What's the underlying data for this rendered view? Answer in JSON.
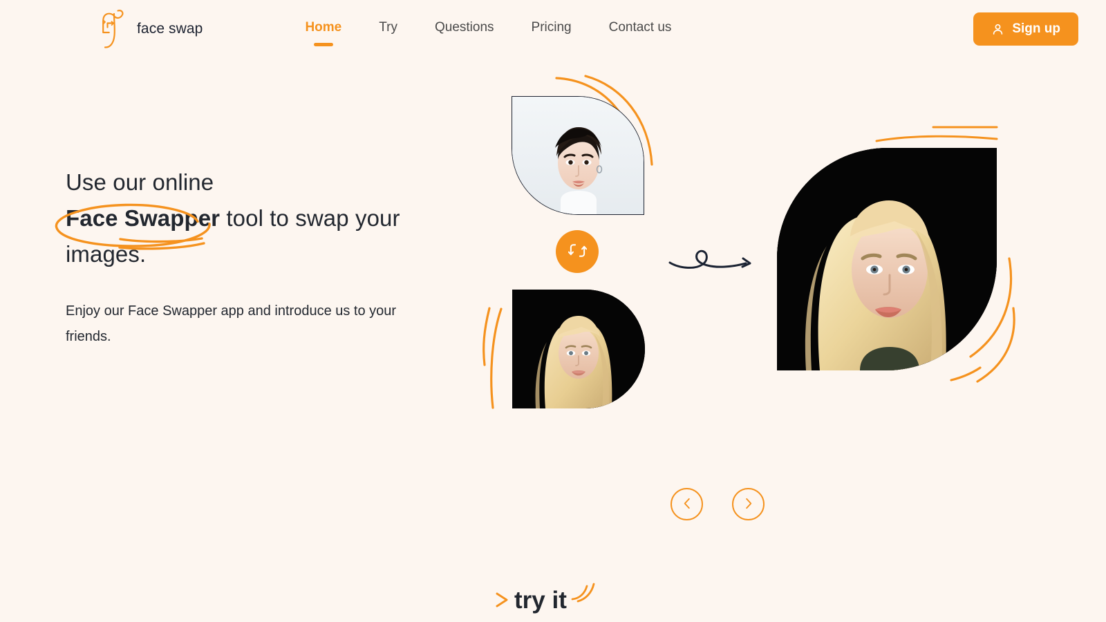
{
  "theme": {
    "background": "#FDF6F0",
    "accent": "#F5921E",
    "text_dark": "#22272F",
    "text_muted": "#4A4A4A"
  },
  "header": {
    "brand": {
      "name": "face swap",
      "logo_icon": "face-swap-logo-icon"
    },
    "nav": [
      {
        "label": "Home",
        "active": true
      },
      {
        "label": "Try",
        "active": false
      },
      {
        "label": "Questions",
        "active": false
      },
      {
        "label": "Pricing",
        "active": false
      },
      {
        "label": "Contact us",
        "active": false
      }
    ],
    "signup": {
      "label": "Sign up",
      "icon": "user-icon"
    }
  },
  "hero": {
    "headline": {
      "line1": "Use our online",
      "highlight": "Face Swapper",
      "line2_rest": " tool to swap your",
      "line3": "images.",
      "annotation": "hand-drawn-orange-ellipse"
    },
    "subcopy": "Enjoy our Face Swapper app and introduce us to your friends."
  },
  "swap_widget": {
    "source_top": {
      "alt": "source-portrait-dark-hair",
      "icon": "portrait-a"
    },
    "source_bottom": {
      "alt": "source-portrait-blonde",
      "icon": "portrait-b"
    },
    "swap_button": {
      "icon": "swap-arrows-icon",
      "label": "Swap images"
    },
    "transition_arrow": "curly-arrow-icon",
    "result": {
      "alt": "result-portrait-swapped-face",
      "icon": "portrait-result"
    }
  },
  "carousel": {
    "prev": {
      "icon": "chevron-left-icon",
      "label": "Previous"
    },
    "next": {
      "icon": "chevron-right-icon",
      "label": "Next"
    }
  },
  "cta": {
    "label": "try it",
    "chevron_icon": "chevron-right-accent-icon",
    "arcs_icon": "decorative-arcs-icon"
  }
}
